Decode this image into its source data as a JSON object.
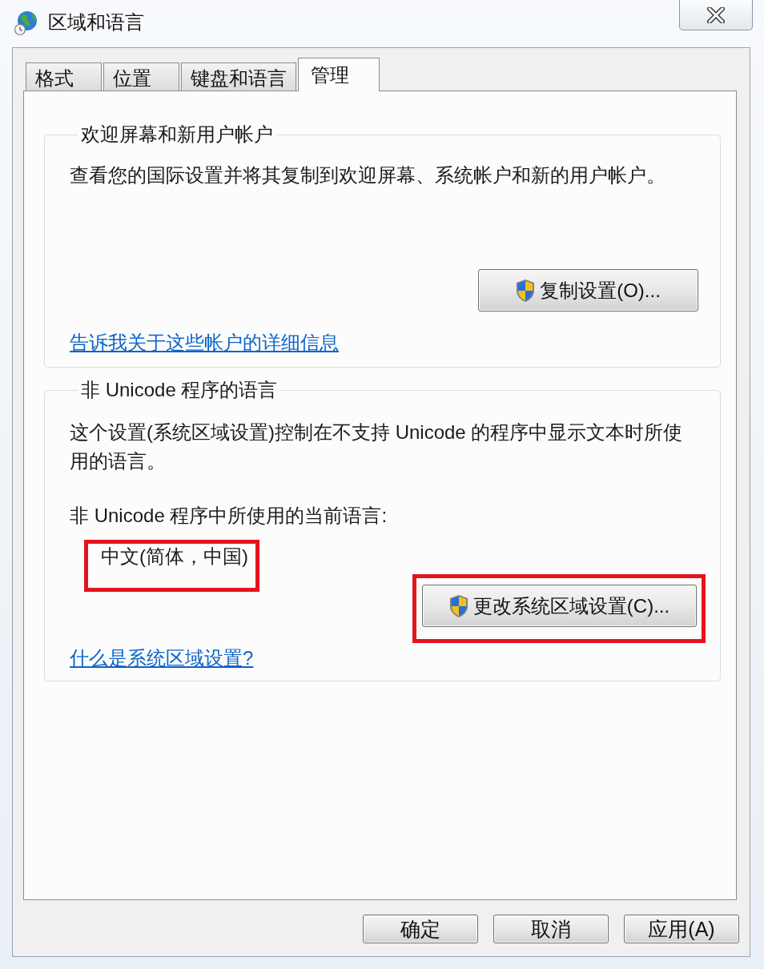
{
  "window": {
    "title": "区域和语言"
  },
  "tabs": [
    {
      "label": "格式",
      "selected": false
    },
    {
      "label": "位置",
      "selected": false
    },
    {
      "label": "键盘和语言",
      "selected": false
    },
    {
      "label": "管理",
      "selected": true
    }
  ],
  "groups": [
    {
      "kind": "welcome",
      "legend": "欢迎屏幕和新用户帐户",
      "description": "查看您的国际设置并将其复制到欢迎屏幕、系统帐户和新的用户帐户。",
      "button": {
        "label": "复制设置(O)..."
      },
      "link": "告诉我关于这些帐户的详细信息"
    },
    {
      "kind": "locale",
      "legend": "非 Unicode 程序的语言",
      "description": "这个设置(系统区域设置)控制在不支持 Unicode 的程序中显示文本时所使用的语言。",
      "current_label": "非 Unicode 程序中所使用的当前语言:",
      "current_value": {
        "text": "中文(简体，中国)",
        "highlighted": true
      },
      "button": {
        "label": "更改系统区域设置(C)...",
        "highlighted": true
      },
      "link": "什么是系统区域设置?"
    }
  ],
  "buttons": [
    {
      "label": "确定"
    },
    {
      "label": "取消"
    },
    {
      "label": "应用(A)"
    }
  ]
}
